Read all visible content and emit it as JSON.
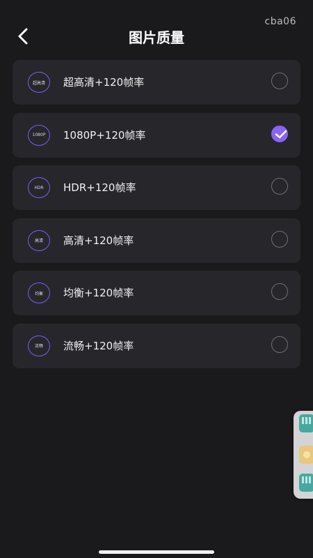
{
  "watermark": "cba06",
  "header": {
    "title": "图片质量"
  },
  "options": [
    {
      "badge": "超高清",
      "label": "超高清+120帧率",
      "selected": false
    },
    {
      "badge": "1080P",
      "label": "1080P+120帧率",
      "selected": true
    },
    {
      "badge": "HDR",
      "label": "HDR+120帧率",
      "selected": false
    },
    {
      "badge": "高清",
      "label": "高清+120帧率",
      "selected": false
    },
    {
      "badge": "均衡",
      "label": "均衡+120帧率",
      "selected": false
    },
    {
      "badge": "流畅",
      "label": "流畅+120帧率",
      "selected": false
    }
  ],
  "colors": {
    "background": "#1a1a1d",
    "card": "#27272b",
    "accent": "#8a63f2",
    "badge_border": "#7b5cf0"
  },
  "icons": {
    "back": "chevron-left-icon",
    "selected": "check-icon"
  }
}
